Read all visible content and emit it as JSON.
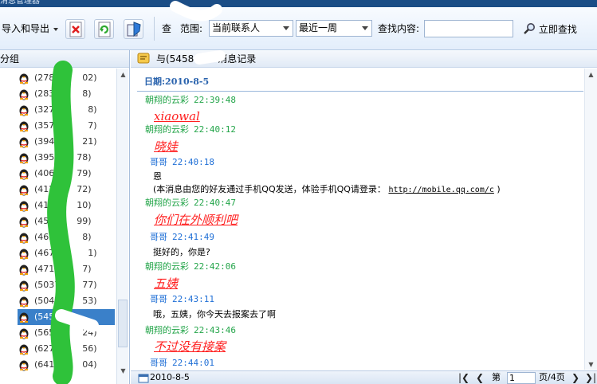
{
  "window": {
    "title": "消息管理器"
  },
  "toolbar": {
    "import_export_label": "导入和导出",
    "range_label_a": "查",
    "range_label_b": "范围:",
    "range_value": "当前联系人",
    "period_value": "最近一周",
    "search_label": "查找内容:",
    "search_value": "",
    "find_now_label": "立即查找"
  },
  "sidebar": {
    "header": "分组",
    "contacts": [
      {
        "name": "(2789",
        "tail": "02)"
      },
      {
        "name": "(2833",
        "tail": "8)"
      },
      {
        "name": "(32752",
        "tail": "8)"
      },
      {
        "name": "(35793",
        "tail": "7)"
      },
      {
        "name": "(3941",
        "tail": "21)"
      },
      {
        "name": "(395",
        "tail": "78)"
      },
      {
        "name": "(406",
        "tail": "79)"
      },
      {
        "name": "(412",
        "tail": "72)"
      },
      {
        "name": "(413",
        "tail": "10)"
      },
      {
        "name": "(450",
        "tail": "99)"
      },
      {
        "name": "(4656",
        "tail": "8)"
      },
      {
        "name": "(46750",
        "tail": "1)"
      },
      {
        "name": "(4718",
        "tail": "7)"
      },
      {
        "name": "(5037",
        "tail": "77)"
      },
      {
        "name": "(5041",
        "tail": "53)"
      },
      {
        "name": "(545",
        "tail": ")"
      },
      {
        "name": "(5658",
        "tail": "24)"
      },
      {
        "name": "(6275",
        "tail": "56)"
      },
      {
        "name": "(6413",
        "tail": "04)"
      }
    ],
    "selected_index": 15
  },
  "log": {
    "title_prefix": "与(5458",
    "title_suffix": "消息记录",
    "date_line": "日期:2010-8-5",
    "entries": [
      {
        "sender": "朝翔的云彩",
        "time": "22:39:48",
        "side": "me",
        "text": "xiaowal",
        "style": "styled"
      },
      {
        "sender": "朝翔的云彩",
        "time": "22:40:12",
        "side": "me",
        "text": "晓娃",
        "style": "styled"
      },
      {
        "sender": "哥哥",
        "time": "22:40:18",
        "side": "other",
        "text": "恩",
        "style": "plain",
        "note": "(本消息由您的好友通过手机QQ发送，体验手机QQ请登录：",
        "link": "http://mobile.qq.com/c",
        "note_end": ")"
      },
      {
        "sender": "朝翔的云彩",
        "time": "22:40:47",
        "side": "me",
        "text": "你们在外顺利吧",
        "style": "styled"
      },
      {
        "sender": "哥哥",
        "time": "22:41:49",
        "side": "other",
        "text": "挺好的，你是?",
        "style": "plain"
      },
      {
        "sender": "朝翔的云彩",
        "time": "22:42:06",
        "side": "me",
        "text": "五姨",
        "style": "styled"
      },
      {
        "sender": "哥哥",
        "time": "22:43:11",
        "side": "other",
        "text": "哦，五姨，你今天去报案去了啊",
        "style": "plain"
      },
      {
        "sender": "朝翔的云彩",
        "time": "22:43:46",
        "side": "me",
        "text": "不过没有接案",
        "style": "styled"
      },
      {
        "sender": "哥哥",
        "time": "22:44:01",
        "side": "other",
        "text": "",
        "style": "plain"
      }
    ]
  },
  "pager": {
    "date": "2010-8-5",
    "page_label": "第",
    "page_value": "1",
    "total_label": "页/4页"
  },
  "colors": {
    "accent": "#3a80c9",
    "me": "#24a54a",
    "other": "#1f6fd6",
    "styled": "#ff2020",
    "marker": "#2fc23a"
  }
}
